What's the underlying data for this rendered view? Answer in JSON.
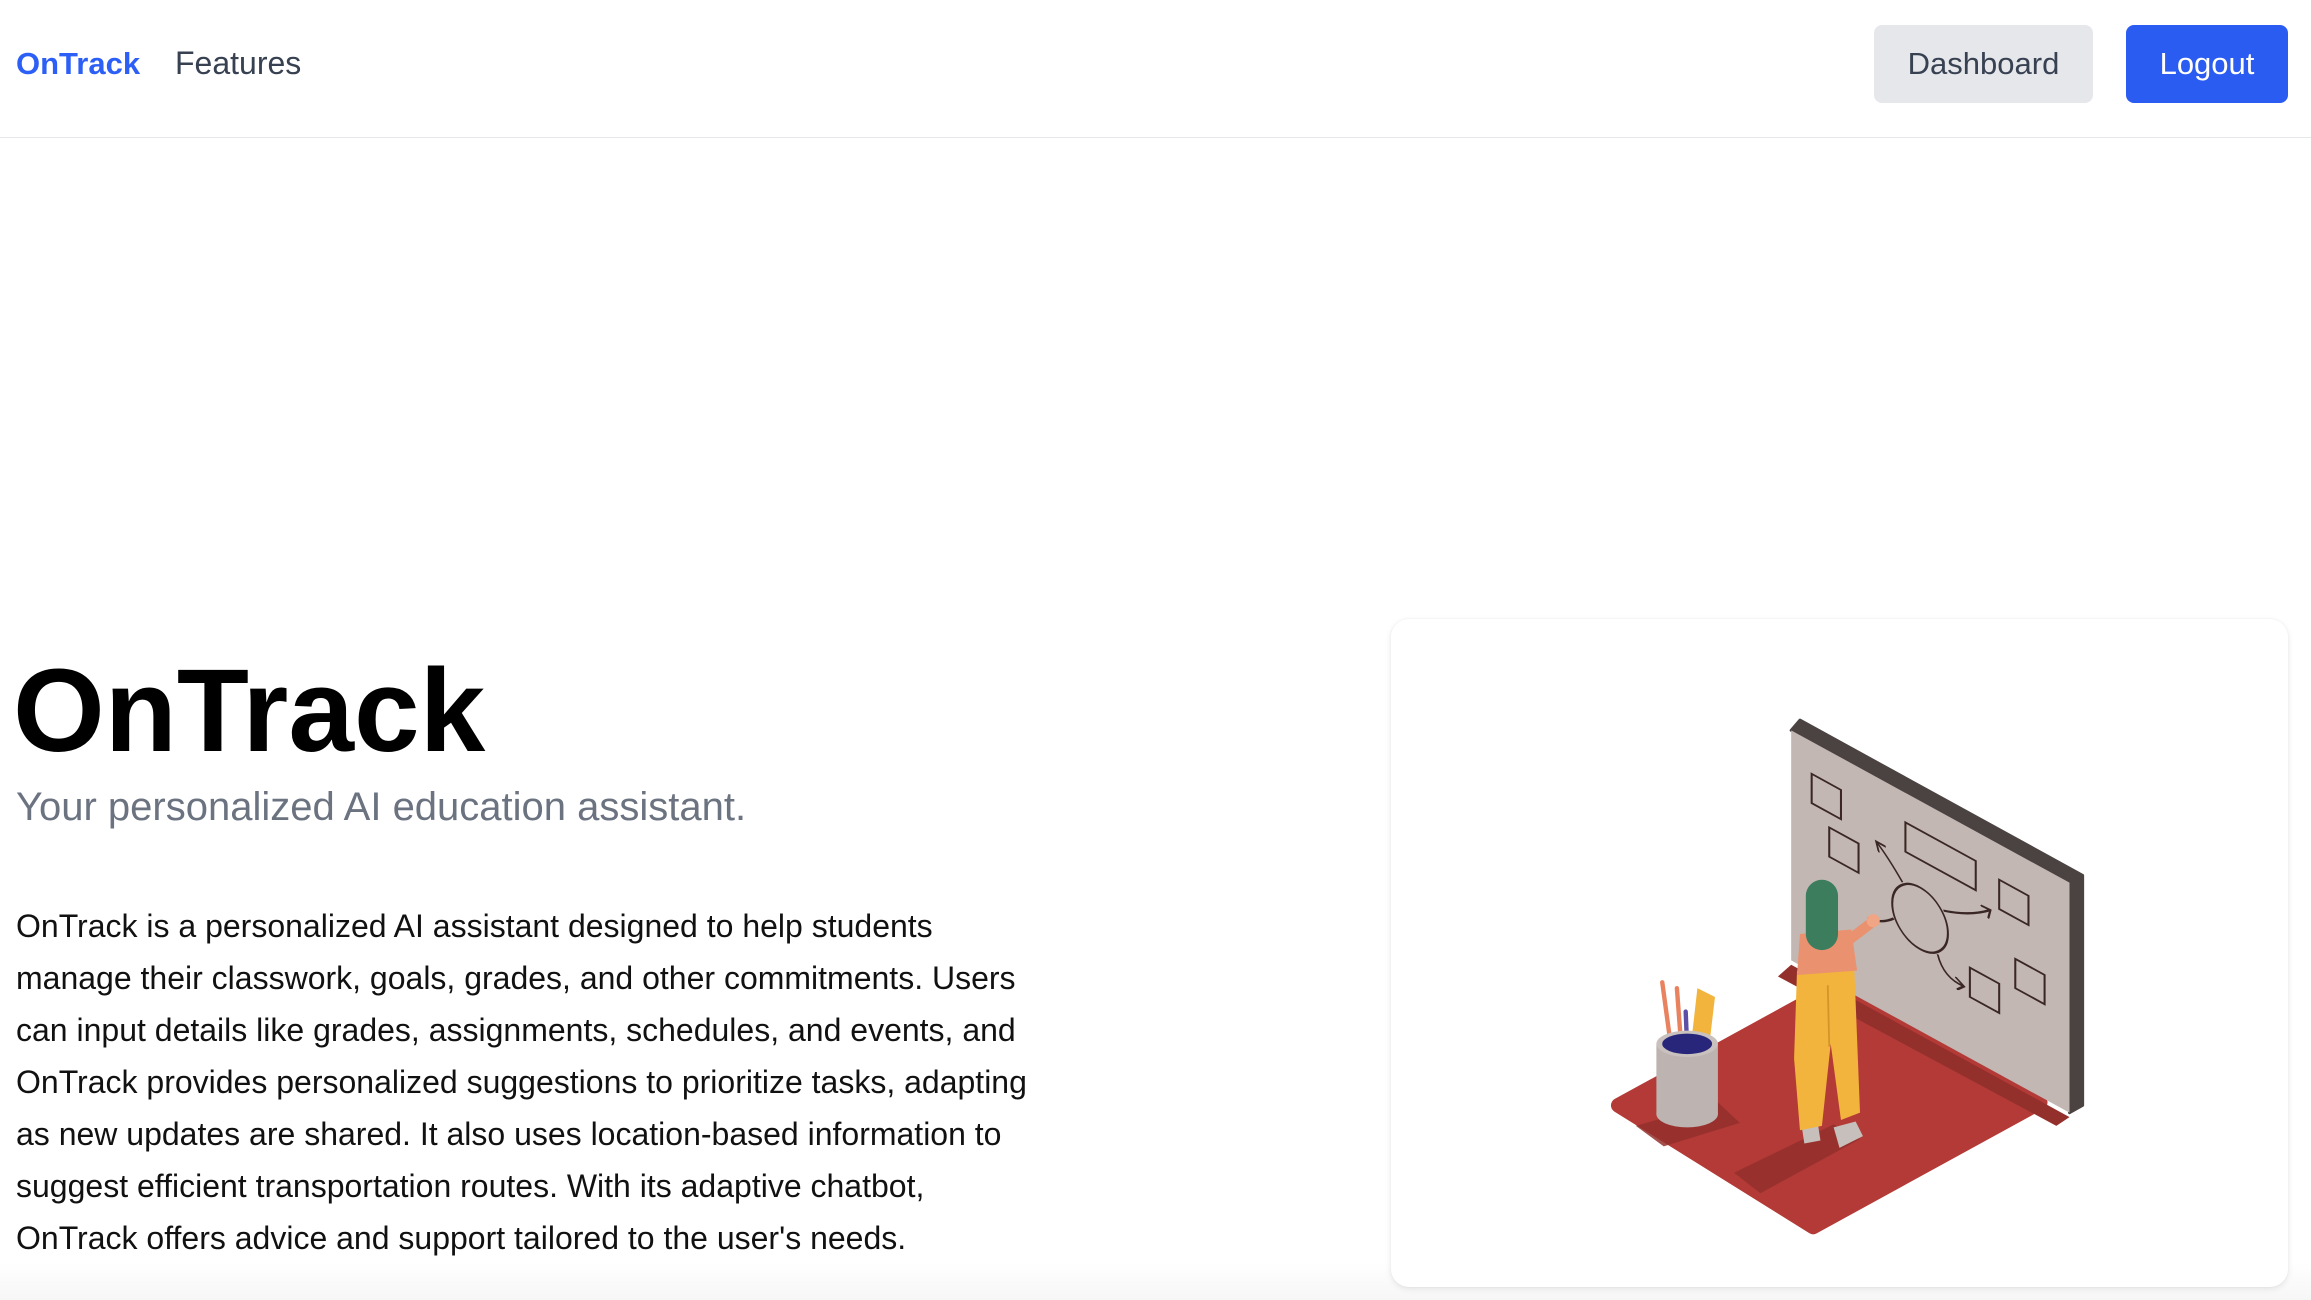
{
  "nav": {
    "logo": "OnTrack",
    "links": [
      "Features"
    ],
    "dashboard_label": "Dashboard",
    "logout_label": "Logout"
  },
  "hero": {
    "title": "OnTrack",
    "subtitle": "Your personalized AI education assistant.",
    "description": "OnTrack is a personalized AI assistant designed to help students manage their classwork, goals, grades, and other commitments. Users can input details like grades, assignments, schedules, and events, and OnTrack provides personalized suggestions to prioritize tasks, adapting as new updates are shared. It also uses location-based information to suggest efficient transportation routes. With its adaptive chatbot, OnTrack offers advice and support tailored to the user's needs."
  },
  "illustration": {
    "icon": "woman-at-whiteboard-illustration"
  },
  "colors": {
    "brand": "#2c5ff5",
    "primary_button": "#2b5cf2",
    "secondary_button": "#e5e7eb",
    "subtitle_text": "#6b7280",
    "floor": "#b33a36",
    "board": "#c2b7b3",
    "hair": "#3b7d5d",
    "pants": "#f2b43c"
  }
}
